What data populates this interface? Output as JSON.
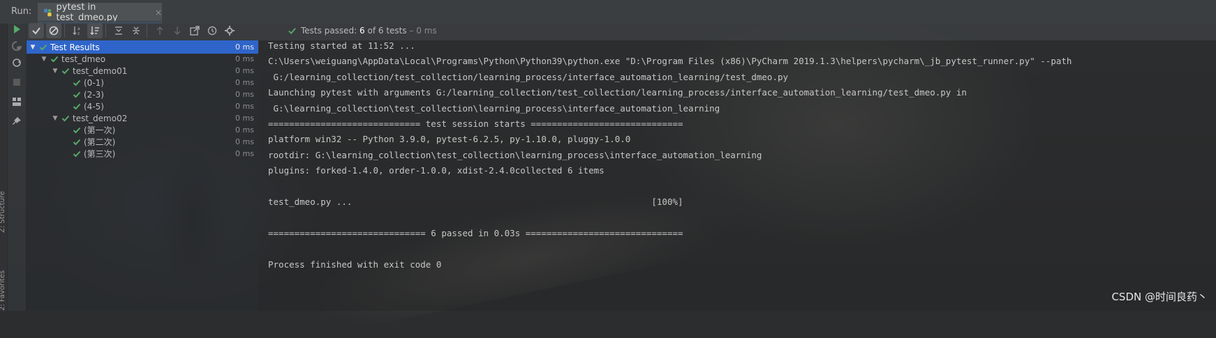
{
  "run_bar": {
    "label": "Run:",
    "tab_title": "pytest in test_dmeo.py",
    "tab_close": "×"
  },
  "side_labels": {
    "structure": "Z: Structure",
    "favorites": "2: Favorites"
  },
  "status": {
    "prefix": "Tests passed:",
    "count": "6",
    "suffix": "of 6 tests",
    "time": "– 0 ms"
  },
  "tree": {
    "rows": [
      {
        "label": "Test Results",
        "time": "0 ms",
        "level": 0,
        "expand": "▼",
        "selected": true
      },
      {
        "label": "test_dmeo",
        "time": "0 ms",
        "level": 1,
        "expand": "▼"
      },
      {
        "label": "test_demo01",
        "time": "0 ms",
        "level": 2,
        "expand": "▼"
      },
      {
        "label": "(0-1)",
        "time": "0 ms",
        "level": 3,
        "expand": ""
      },
      {
        "label": "(2-3)",
        "time": "0 ms",
        "level": 3,
        "expand": ""
      },
      {
        "label": "(4-5)",
        "time": "0 ms",
        "level": 3,
        "expand": ""
      },
      {
        "label": "test_demo02",
        "time": "0 ms",
        "level": 2,
        "expand": "▼"
      },
      {
        "label": "(第一次)",
        "time": "0 ms",
        "level": 3,
        "expand": ""
      },
      {
        "label": "(第二次)",
        "time": "0 ms",
        "level": 3,
        "expand": ""
      },
      {
        "label": "(第三次)",
        "time": "0 ms",
        "level": 3,
        "expand": ""
      }
    ]
  },
  "console": {
    "lines": [
      "Testing started at 11:52 ...",
      "C:\\Users\\weiguang\\AppData\\Local\\Programs\\Python\\Python39\\python.exe \"D:\\Program Files (x86)\\PyCharm 2019.1.3\\helpers\\pycharm\\_jb_pytest_runner.py\" --path",
      " G:/learning_collection/test_collection/learning_process/interface_automation_learning/test_dmeo.py",
      "Launching pytest with arguments G:/learning_collection/test_collection/learning_process/interface_automation_learning/test_dmeo.py in",
      " G:\\learning_collection\\test_collection\\learning_process\\interface_automation_learning",
      "============================= test session starts =============================",
      "platform win32 -- Python 3.9.0, pytest-6.2.5, py-1.10.0, pluggy-1.0.0",
      "rootdir: G:\\learning_collection\\test_collection\\learning_process\\interface_automation_learning",
      "plugins: forked-1.4.0, order-1.0.0, xdist-2.4.0collected 6 items",
      "",
      "test_dmeo.py ...                                                         [100%]",
      "",
      "============================== 6 passed in 0.03s ==============================",
      "",
      "Process finished with exit code 0"
    ]
  },
  "watermark": "CSDN @时间良药丶",
  "colors": {
    "pass_green": "#59a869",
    "selection_blue": "#2f65ca",
    "tab_underline": "#4a88c7"
  }
}
